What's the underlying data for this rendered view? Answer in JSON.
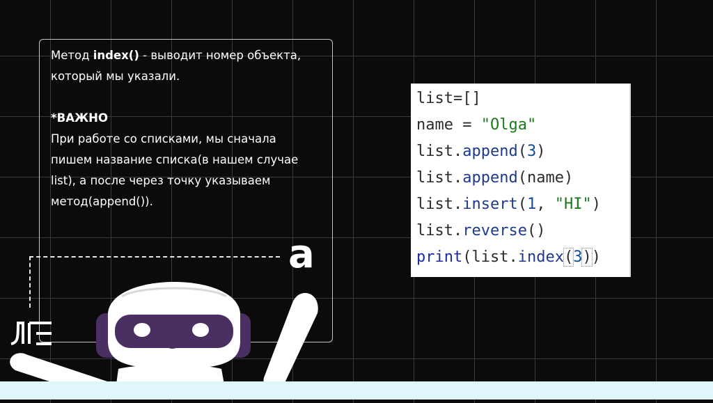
{
  "description": {
    "line1_prefix": "Метод ",
    "line1_bold": "index()",
    "line1_suffix": " - выводит номер объекта,",
    "line2": "который мы указали.",
    "important": "*ВАЖНО",
    "line3": "При работе со списками, мы сначала",
    "line4": "пишем название списка(в нашем случае",
    "line5": "list), а после через точку указываем",
    "line6": "метод(append())."
  },
  "corner_letter": "a",
  "logo_text": "ЛЕ",
  "code": [
    [
      {
        "t": "list=[]",
        "c": "tk-default"
      }
    ],
    [
      {
        "t": "name = ",
        "c": "tk-default"
      },
      {
        "t": "\"Olga\"",
        "c": "tk-str"
      }
    ],
    [
      {
        "t": "list.",
        "c": "tk-default"
      },
      {
        "t": "append",
        "c": "tk-method"
      },
      {
        "t": "(",
        "c": "tk-default"
      },
      {
        "t": "3",
        "c": "tk-num"
      },
      {
        "t": ")",
        "c": "tk-default"
      }
    ],
    [
      {
        "t": "list.",
        "c": "tk-default"
      },
      {
        "t": "append",
        "c": "tk-method"
      },
      {
        "t": "(name)",
        "c": "tk-default"
      }
    ],
    [
      {
        "t": "list.",
        "c": "tk-default"
      },
      {
        "t": "insert",
        "c": "tk-method"
      },
      {
        "t": "(",
        "c": "tk-default"
      },
      {
        "t": "1",
        "c": "tk-num"
      },
      {
        "t": ", ",
        "c": "tk-default"
      },
      {
        "t": "\"HI\"",
        "c": "tk-str"
      },
      {
        "t": ")",
        "c": "tk-default"
      }
    ],
    [
      {
        "t": "list.",
        "c": "tk-default"
      },
      {
        "t": "reverse",
        "c": "tk-method"
      },
      {
        "t": "()",
        "c": "tk-default"
      }
    ],
    [
      {
        "t": "print",
        "c": "tk-print"
      },
      {
        "t": "(list.",
        "c": "tk-default"
      },
      {
        "t": "index",
        "c": "tk-method"
      },
      {
        "t": "(",
        "c": "tk-default cursor-box"
      },
      {
        "t": "3",
        "c": "tk-num"
      },
      {
        "t": ")",
        "c": "tk-default cursor-box"
      },
      {
        "t": ")",
        "c": "tk-default"
      }
    ]
  ],
  "colors": {
    "background": "#0b0b0b",
    "grid": "#3a3a3a",
    "robot_purple": "#4a2f63",
    "floor": "#dff7fb"
  }
}
